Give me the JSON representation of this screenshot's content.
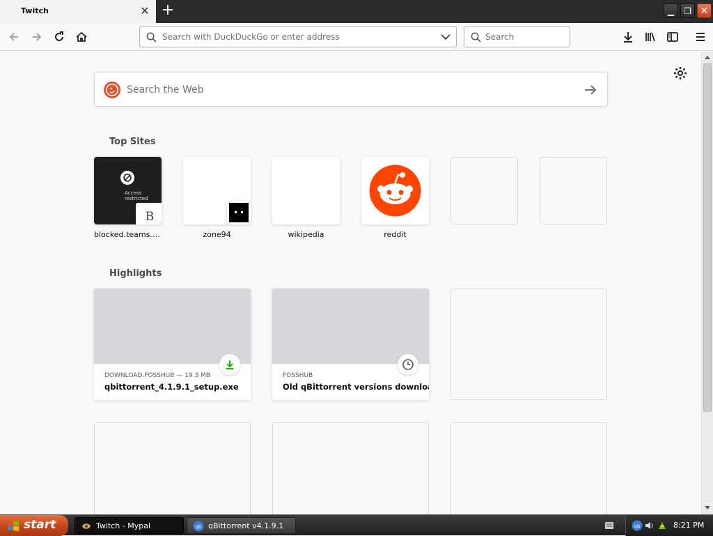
{
  "browser": {
    "tab": {
      "title": "Twitch"
    },
    "urlbar": {
      "placeholder": "Search with DuckDuckGo or enter address"
    },
    "searchbar": {
      "placeholder": "Search"
    }
  },
  "newtab": {
    "websearch": {
      "placeholder": "Search the Web"
    },
    "top_sites_title": "Top Sites",
    "top_sites": [
      {
        "label": "blocked.teams.clo...",
        "thumb_text": "Access restricted",
        "badge_letter": "B"
      },
      {
        "label": "zone94"
      },
      {
        "label": "wikipedia"
      },
      {
        "label": "reddit"
      },
      {
        "label": ""
      },
      {
        "label": ""
      }
    ],
    "highlights_title": "Highlights",
    "highlights": [
      {
        "meta": "DOWNLOAD.FOSSHUB — 19.3 MB",
        "title": "qbittorrent_4.1.9.1_setup.exe",
        "badge": "download-icon"
      },
      {
        "meta": "FOSSHUB",
        "title": "Old qBittorrent versions download",
        "badge": "clock-icon"
      }
    ]
  },
  "taskbar": {
    "start_label": "start",
    "items": [
      {
        "label": "Twitch - Mypal"
      },
      {
        "label": "qBittorrent v4.1.9.1"
      }
    ],
    "clock": "8:21 PM"
  },
  "colors": {
    "reddit": "#ff4500",
    "duckduckgo": "#de5833",
    "download_green": "#12bc00",
    "start_orange": "#d8582a"
  }
}
